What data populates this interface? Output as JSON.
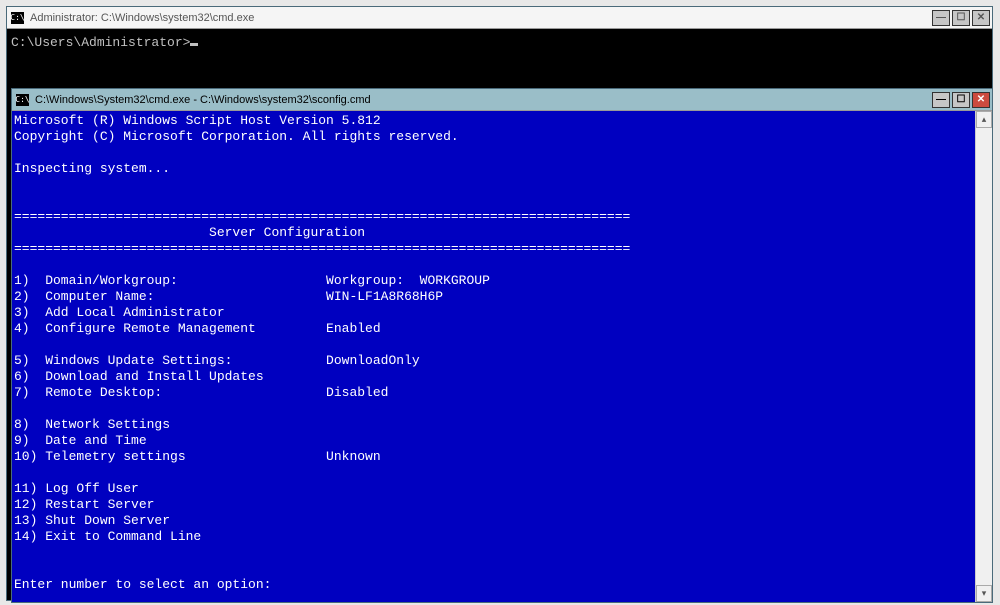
{
  "back_window": {
    "title": "Administrator: C:\\Windows\\system32\\cmd.exe",
    "prompt": "C:\\Users\\Administrator>",
    "buttons": {
      "min": "—",
      "max": "☐",
      "close": "✕"
    }
  },
  "front_window": {
    "title": "C:\\Windows\\System32\\cmd.exe - C:\\Windows\\system32\\sconfig.cmd",
    "buttons": {
      "min": "—",
      "max": "☐",
      "close": "✕"
    },
    "header_line1": "Microsoft (R) Windows Script Host Version 5.812",
    "header_line2": "Copyright (C) Microsoft Corporation. All rights reserved.",
    "inspecting": "Inspecting system...",
    "divider": "===============================================================================",
    "banner": "                         Server Configuration",
    "menu": [
      {
        "n": "1)",
        "label": "Domain/Workgroup:",
        "value": "Workgroup:  WORKGROUP"
      },
      {
        "n": "2)",
        "label": "Computer Name:",
        "value": "WIN-LF1A8R68H6P"
      },
      {
        "n": "3)",
        "label": "Add Local Administrator",
        "value": ""
      },
      {
        "n": "4)",
        "label": "Configure Remote Management",
        "value": "Enabled"
      },
      {
        "n": "",
        "label": "",
        "value": ""
      },
      {
        "n": "5)",
        "label": "Windows Update Settings:",
        "value": "DownloadOnly"
      },
      {
        "n": "6)",
        "label": "Download and Install Updates",
        "value": ""
      },
      {
        "n": "7)",
        "label": "Remote Desktop:",
        "value": "Disabled"
      },
      {
        "n": "",
        "label": "",
        "value": ""
      },
      {
        "n": "8)",
        "label": "Network Settings",
        "value": ""
      },
      {
        "n": "9)",
        "label": "Date and Time",
        "value": ""
      },
      {
        "n": "10)",
        "label": "Telemetry settings",
        "value": "Unknown"
      },
      {
        "n": "",
        "label": "",
        "value": ""
      },
      {
        "n": "11)",
        "label": "Log Off User",
        "value": ""
      },
      {
        "n": "12)",
        "label": "Restart Server",
        "value": ""
      },
      {
        "n": "13)",
        "label": "Shut Down Server",
        "value": ""
      },
      {
        "n": "14)",
        "label": "Exit to Command Line",
        "value": ""
      }
    ],
    "prompt": "Enter number to select an option:"
  },
  "scrollbar": {
    "up": "▴",
    "down": "▾"
  }
}
